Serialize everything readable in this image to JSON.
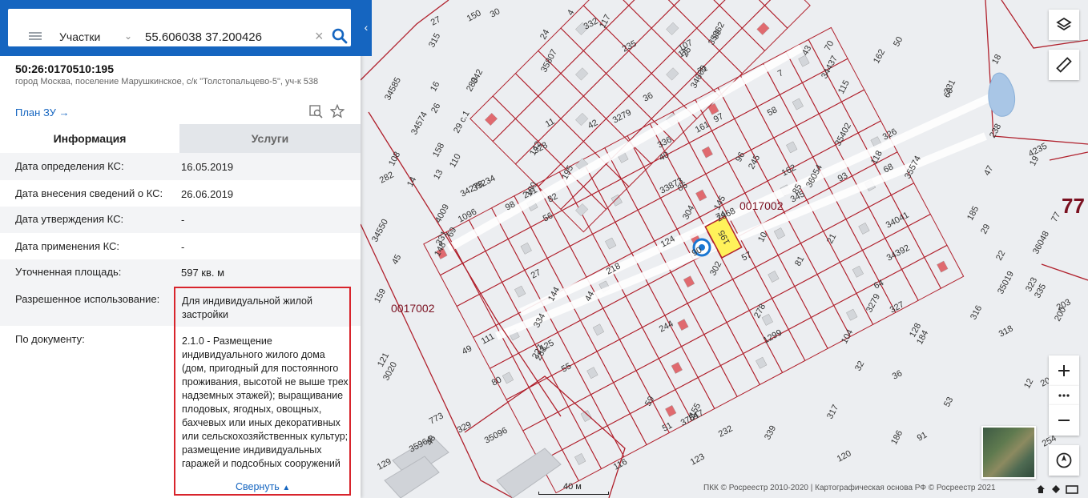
{
  "search": {
    "type_label": "Участки",
    "query": "55.606038 37.200426"
  },
  "parcel": {
    "cadastral_number": "50:26:0170510:195",
    "address": "город Москва, поселение Марушкинское, с/к \"Толстопальцево-5\", уч-к 538",
    "plan_link": "План ЗУ →"
  },
  "tabs": [
    {
      "label": "Информация",
      "active": true
    },
    {
      "label": "Услуги",
      "active": false
    }
  ],
  "info_rows": [
    {
      "key": "Дата определения КС:",
      "value": "16.05.2019"
    },
    {
      "key": "Дата внесения сведений о КС:",
      "value": "26.06.2019"
    },
    {
      "key": "Дата утверждения КС:",
      "value": "-"
    },
    {
      "key": "Дата применения КС:",
      "value": "-"
    },
    {
      "key": "Уточненная площадь:",
      "value": "597 кв. м"
    },
    {
      "key": "Разрешенное использование:",
      "value": "Для индивидуальной жилой застройки"
    },
    {
      "key": "По документу:",
      "value": "2.1.0 - Размещение индивидуального жилого дома (дом, пригодный для постоянного проживания, высотой не выше трех надземных этажей); выращивание плодовых, ягодных, овощных, бахчевых или иных декоративных или сельскохозяйственных культур; размещение индивидуальных гаражей и подсобных сооружений"
    }
  ],
  "collapse_label": "Свернуть",
  "map": {
    "quarter_labels": [
      "0017002",
      "0017002"
    ],
    "selected_plot": "195",
    "big_region": "77",
    "plot_numbers": [
      "302",
      "56",
      "773",
      "336",
      "70",
      "334",
      "10",
      "35964",
      "1096",
      "98",
      "35402",
      "77",
      "245",
      "35574",
      "48",
      "29",
      "345",
      "34437",
      "25",
      "244",
      "19",
      "74",
      "304",
      "283",
      "55",
      "254",
      "327",
      "108",
      "241",
      "326",
      "282",
      "15",
      "84",
      "71",
      "238",
      "111",
      "317",
      "331",
      "27",
      "53",
      "99",
      "35062",
      "328",
      "280",
      "43",
      "69",
      "121",
      "68",
      "3279",
      "235",
      "315",
      "332",
      "86",
      "22",
      "329",
      "232",
      "123",
      "124",
      "91",
      "203",
      "107",
      "278",
      "36",
      "37517",
      "14",
      "200",
      "115",
      "96",
      "36048",
      "36",
      "227",
      "35019",
      "60",
      "51",
      "16",
      "82",
      "117",
      "34041",
      "18",
      "180",
      "49",
      "45",
      "3279",
      "97",
      "325",
      "12",
      "26",
      "64",
      "195",
      "35096",
      "184",
      "7",
      "335",
      "218",
      "34278",
      "34392",
      "85",
      "35234",
      "186",
      "185",
      "47",
      "24",
      "116",
      "81",
      "34606",
      "42",
      "58",
      "21",
      "34550",
      "159",
      "158",
      "120",
      "30",
      "17",
      "339",
      "44",
      "36054",
      "323",
      "104",
      "35807",
      "34574",
      "57",
      "13",
      "342",
      "110",
      "40",
      "90",
      "93",
      "161",
      "144",
      "155",
      "145",
      "128",
      "162",
      "50",
      "4",
      "118",
      "2868",
      "3020",
      "32",
      "20",
      "142",
      "318",
      "33873",
      "80",
      "162",
      "4009",
      "148",
      "129",
      "11",
      "125",
      "59",
      "150",
      "316",
      "34585",
      "25",
      "27",
      "29 с.1",
      "331",
      "1299",
      "4235"
    ]
  },
  "scale_label": "40 м",
  "attribution": "ПКК © Росреестр 2010-2020 | Картографическая основа РФ © Росреестр 2021",
  "colors": {
    "brand_blue": "#1565c0",
    "parcel_red": "#b0202c",
    "selected_yellow": "#fff25a",
    "highlight_red": "#d8242c"
  }
}
